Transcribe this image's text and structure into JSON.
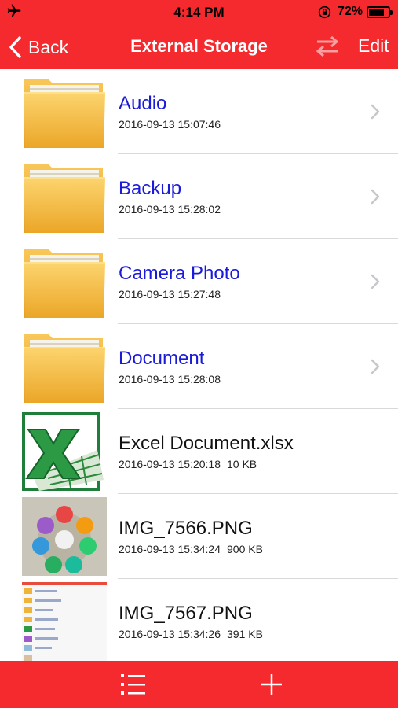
{
  "status_bar": {
    "time": "4:14 PM",
    "battery_text": "72%",
    "battery_level": 0.72,
    "icons": [
      "airplane-icon",
      "orientation-lock-icon",
      "battery-icon"
    ]
  },
  "nav": {
    "back_label": "Back",
    "title": "External Storage",
    "edit_label": "Edit",
    "icons": [
      "back-chevron-icon",
      "swap-arrows-icon"
    ]
  },
  "colors": {
    "bar": "#f42a2e",
    "folder_name": "#1a1adb",
    "file_name": "#111111",
    "separator": "#d9d9d9"
  },
  "files": [
    {
      "name": "Audio",
      "date": "2016-09-13 15:07:46",
      "size": "",
      "type": "folder",
      "icon": "folder-icon"
    },
    {
      "name": "Backup",
      "date": "2016-09-13 15:28:02",
      "size": "",
      "type": "folder",
      "icon": "folder-icon"
    },
    {
      "name": "Camera Photo",
      "date": "2016-09-13 15:27:48",
      "size": "",
      "type": "folder",
      "icon": "folder-icon"
    },
    {
      "name": "Document",
      "date": "2016-09-13 15:28:08",
      "size": "",
      "type": "folder",
      "icon": "folder-icon"
    },
    {
      "name": "Excel Document.xlsx",
      "date": "2016-09-13 15:20:18",
      "size": "10 KB",
      "type": "file",
      "icon": "excel-file-icon"
    },
    {
      "name": "IMG_7566.PNG",
      "date": "2016-09-13 15:34:24",
      "size": "900 KB",
      "type": "file",
      "icon": "image-thumbnail"
    },
    {
      "name": "IMG_7567.PNG",
      "date": "2016-09-13 15:34:26",
      "size": "391 KB",
      "type": "file",
      "icon": "screenshot-thumbnail"
    }
  ],
  "tab_bar": {
    "icons": [
      "list-icon",
      "plus-icon"
    ]
  }
}
